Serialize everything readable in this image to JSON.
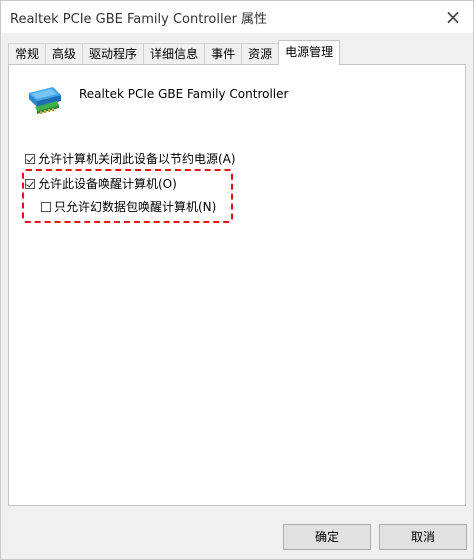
{
  "window": {
    "title": "Realtek PCIe GBE Family Controller 属性",
    "close_glyph": "×"
  },
  "tabs": [
    {
      "label": "常规"
    },
    {
      "label": "高级"
    },
    {
      "label": "驱动程序"
    },
    {
      "label": "详细信息"
    },
    {
      "label": "事件"
    },
    {
      "label": "资源"
    },
    {
      "label": "电源管理",
      "active": true
    }
  ],
  "device": {
    "name": "Realtek PCIe GBE Family Controller",
    "icon": "network-adapter-icon"
  },
  "options": {
    "allow_turn_off": {
      "label": "允许计算机关闭此设备以节约电源(A)",
      "checked": true
    },
    "allow_wake": {
      "label": "允许此设备唤醒计算机(O)",
      "checked": true
    },
    "magic_packet_only": {
      "label": "只允许幻数据包唤醒计算机(N)",
      "checked": false
    }
  },
  "highlight_color": "#e3161b",
  "buttons": {
    "ok": "确定",
    "cancel": "取消"
  }
}
